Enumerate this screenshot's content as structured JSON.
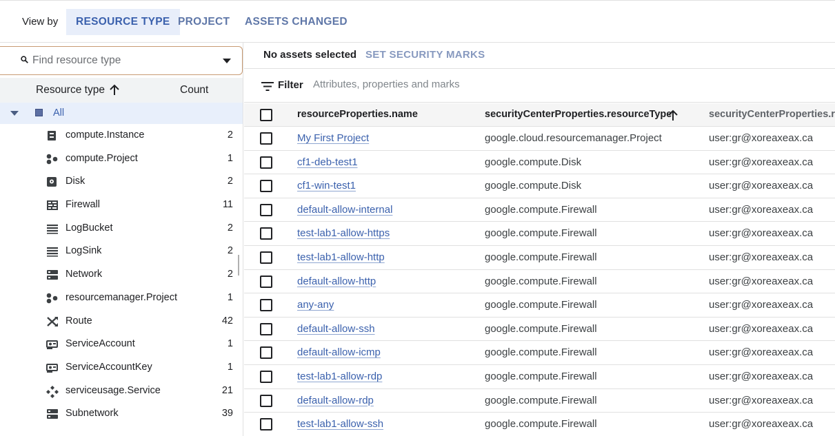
{
  "viewby": {
    "label": "View by",
    "tabs": [
      {
        "label": "RESOURCE TYPE",
        "active": true
      },
      {
        "label": "PROJECT",
        "active": false
      },
      {
        "label": "ASSETS CHANGED",
        "active": false
      }
    ]
  },
  "search": {
    "placeholder": "Find resource type"
  },
  "resource_header": {
    "type_label": "Resource type",
    "count_label": "Count"
  },
  "all_item": {
    "label": "All"
  },
  "resources": [
    {
      "name": "compute.Instance",
      "count": "2",
      "icon": "instance-icon"
    },
    {
      "name": "compute.Project",
      "count": "1",
      "icon": "project-icon"
    },
    {
      "name": "Disk",
      "count": "2",
      "icon": "disk-icon"
    },
    {
      "name": "Firewall",
      "count": "11",
      "icon": "firewall-icon"
    },
    {
      "name": "LogBucket",
      "count": "2",
      "icon": "logbucket-icon"
    },
    {
      "name": "LogSink",
      "count": "2",
      "icon": "logsink-icon"
    },
    {
      "name": "Network",
      "count": "2",
      "icon": "network-icon"
    },
    {
      "name": "resourcemanager.Project",
      "count": "1",
      "icon": "project-icon"
    },
    {
      "name": "Route",
      "count": "42",
      "icon": "route-icon"
    },
    {
      "name": "ServiceAccount",
      "count": "1",
      "icon": "service-account-icon"
    },
    {
      "name": "ServiceAccountKey",
      "count": "1",
      "icon": "service-account-key-icon"
    },
    {
      "name": "serviceusage.Service",
      "count": "21",
      "icon": "service-icon"
    },
    {
      "name": "Subnetwork",
      "count": "39",
      "icon": "subnetwork-icon"
    }
  ],
  "selection": {
    "status": "No assets selected",
    "action": "SET SECURITY MARKS"
  },
  "filter": {
    "label": "Filter",
    "placeholder": "Attributes, properties and marks"
  },
  "table": {
    "columns": [
      "resourceProperties.name",
      "securityCenterProperties.resourceType",
      "securityCenterProperties.res"
    ],
    "rows": [
      {
        "name": "My First Project",
        "type": "google.cloud.resourcemanager.Project",
        "owner": "user:gr@xoreaxeax.ca"
      },
      {
        "name": "cf1-deb-test1",
        "type": "google.compute.Disk",
        "owner": "user:gr@xoreaxeax.ca"
      },
      {
        "name": "cf1-win-test1",
        "type": "google.compute.Disk",
        "owner": "user:gr@xoreaxeax.ca"
      },
      {
        "name": "default-allow-internal",
        "type": "google.compute.Firewall",
        "owner": "user:gr@xoreaxeax.ca"
      },
      {
        "name": "test-lab1-allow-https",
        "type": "google.compute.Firewall",
        "owner": "user:gr@xoreaxeax.ca"
      },
      {
        "name": "test-lab1-allow-http",
        "type": "google.compute.Firewall",
        "owner": "user:gr@xoreaxeax.ca"
      },
      {
        "name": "default-allow-http",
        "type": "google.compute.Firewall",
        "owner": "user:gr@xoreaxeax.ca"
      },
      {
        "name": "any-any",
        "type": "google.compute.Firewall",
        "owner": "user:gr@xoreaxeax.ca"
      },
      {
        "name": "default-allow-ssh",
        "type": "google.compute.Firewall",
        "owner": "user:gr@xoreaxeax.ca"
      },
      {
        "name": "default-allow-icmp",
        "type": "google.compute.Firewall",
        "owner": "user:gr@xoreaxeax.ca"
      },
      {
        "name": "test-lab1-allow-rdp",
        "type": "google.compute.Firewall",
        "owner": "user:gr@xoreaxeax.ca"
      },
      {
        "name": "default-allow-rdp",
        "type": "google.compute.Firewall",
        "owner": "user:gr@xoreaxeax.ca"
      },
      {
        "name": "test-lab1-allow-ssh",
        "type": "google.compute.Firewall",
        "owner": "user:gr@xoreaxeax.ca"
      }
    ]
  }
}
